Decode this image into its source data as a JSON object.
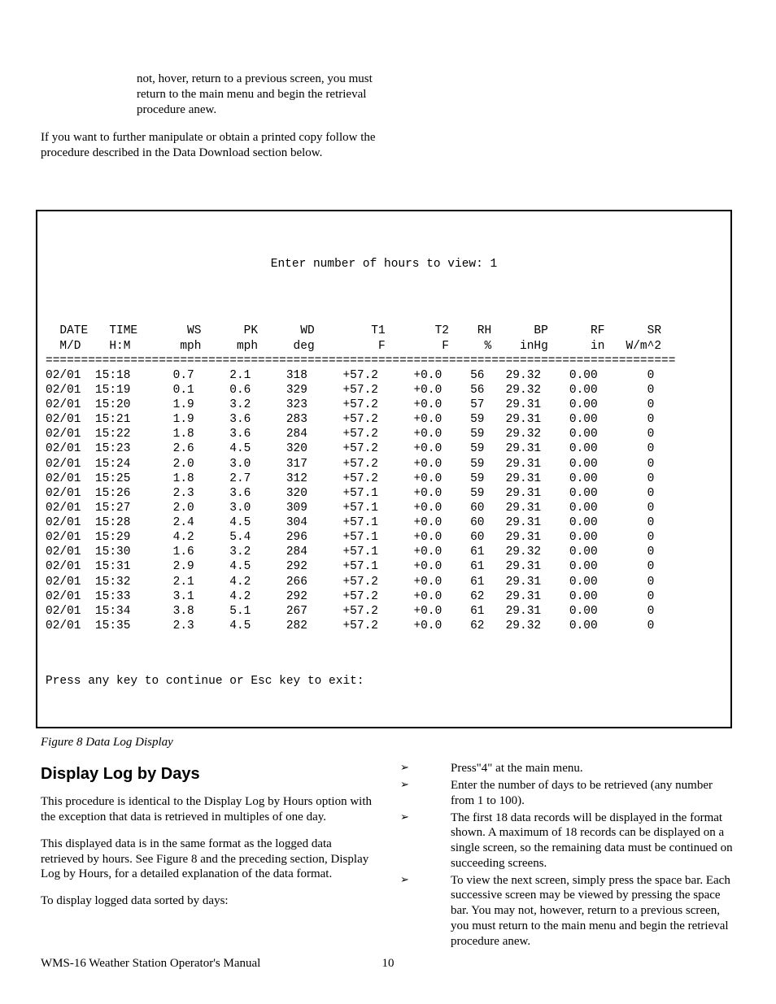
{
  "pre": {
    "hover_text": "not, hover, return to a previous screen, you must return to the main menu and begin the retrieval procedure anew.",
    "manip_text": "If you want to further manipulate or obtain a printed copy follow the procedure described in the Data Download section below."
  },
  "terminal": {
    "prompt": "Enter number of hours to view: 1",
    "headers": [
      {
        "l1": "DATE",
        "l2": "M/D"
      },
      {
        "l1": "TIME",
        "l2": "H:M"
      },
      {
        "l1": "WS",
        "l2": "mph"
      },
      {
        "l1": "PK",
        "l2": "mph"
      },
      {
        "l1": "WD",
        "l2": "deg"
      },
      {
        "l1": "T1",
        "l2": "F"
      },
      {
        "l1": "T2",
        "l2": "F"
      },
      {
        "l1": "RH",
        "l2": "%"
      },
      {
        "l1": "BP",
        "l2": "inHg"
      },
      {
        "l1": "RF",
        "l2": "in"
      },
      {
        "l1": "SR",
        "l2": "W/m^2"
      }
    ],
    "rows": [
      {
        "date": "02/01",
        "time": "15:18",
        "ws": "0.7",
        "pk": "2.1",
        "wd": "318",
        "t1": "+57.2",
        "t2": "+0.0",
        "rh": "56",
        "bp": "29.32",
        "rf": "0.00",
        "sr": "0"
      },
      {
        "date": "02/01",
        "time": "15:19",
        "ws": "0.1",
        "pk": "0.6",
        "wd": "329",
        "t1": "+57.2",
        "t2": "+0.0",
        "rh": "56",
        "bp": "29.32",
        "rf": "0.00",
        "sr": "0"
      },
      {
        "date": "02/01",
        "time": "15:20",
        "ws": "1.9",
        "pk": "3.2",
        "wd": "323",
        "t1": "+57.2",
        "t2": "+0.0",
        "rh": "57",
        "bp": "29.31",
        "rf": "0.00",
        "sr": "0"
      },
      {
        "date": "02/01",
        "time": "15:21",
        "ws": "1.9",
        "pk": "3.6",
        "wd": "283",
        "t1": "+57.2",
        "t2": "+0.0",
        "rh": "59",
        "bp": "29.31",
        "rf": "0.00",
        "sr": "0"
      },
      {
        "date": "02/01",
        "time": "15:22",
        "ws": "1.8",
        "pk": "3.6",
        "wd": "284",
        "t1": "+57.2",
        "t2": "+0.0",
        "rh": "59",
        "bp": "29.32",
        "rf": "0.00",
        "sr": "0"
      },
      {
        "date": "02/01",
        "time": "15:23",
        "ws": "2.6",
        "pk": "4.5",
        "wd": "320",
        "t1": "+57.2",
        "t2": "+0.0",
        "rh": "59",
        "bp": "29.31",
        "rf": "0.00",
        "sr": "0"
      },
      {
        "date": "02/01",
        "time": "15:24",
        "ws": "2.0",
        "pk": "3.0",
        "wd": "317",
        "t1": "+57.2",
        "t2": "+0.0",
        "rh": "59",
        "bp": "29.31",
        "rf": "0.00",
        "sr": "0"
      },
      {
        "date": "02/01",
        "time": "15:25",
        "ws": "1.8",
        "pk": "2.7",
        "wd": "312",
        "t1": "+57.2",
        "t2": "+0.0",
        "rh": "59",
        "bp": "29.31",
        "rf": "0.00",
        "sr": "0"
      },
      {
        "date": "02/01",
        "time": "15:26",
        "ws": "2.3",
        "pk": "3.6",
        "wd": "320",
        "t1": "+57.1",
        "t2": "+0.0",
        "rh": "59",
        "bp": "29.31",
        "rf": "0.00",
        "sr": "0"
      },
      {
        "date": "02/01",
        "time": "15:27",
        "ws": "2.0",
        "pk": "3.0",
        "wd": "309",
        "t1": "+57.1",
        "t2": "+0.0",
        "rh": "60",
        "bp": "29.31",
        "rf": "0.00",
        "sr": "0"
      },
      {
        "date": "02/01",
        "time": "15:28",
        "ws": "2.4",
        "pk": "4.5",
        "wd": "304",
        "t1": "+57.1",
        "t2": "+0.0",
        "rh": "60",
        "bp": "29.31",
        "rf": "0.00",
        "sr": "0"
      },
      {
        "date": "02/01",
        "time": "15:29",
        "ws": "4.2",
        "pk": "5.4",
        "wd": "296",
        "t1": "+57.1",
        "t2": "+0.0",
        "rh": "60",
        "bp": "29.31",
        "rf": "0.00",
        "sr": "0"
      },
      {
        "date": "02/01",
        "time": "15:30",
        "ws": "1.6",
        "pk": "3.2",
        "wd": "284",
        "t1": "+57.1",
        "t2": "+0.0",
        "rh": "61",
        "bp": "29.32",
        "rf": "0.00",
        "sr": "0"
      },
      {
        "date": "02/01",
        "time": "15:31",
        "ws": "2.9",
        "pk": "4.5",
        "wd": "292",
        "t1": "+57.1",
        "t2": "+0.0",
        "rh": "61",
        "bp": "29.31",
        "rf": "0.00",
        "sr": "0"
      },
      {
        "date": "02/01",
        "time": "15:32",
        "ws": "2.1",
        "pk": "4.2",
        "wd": "266",
        "t1": "+57.2",
        "t2": "+0.0",
        "rh": "61",
        "bp": "29.31",
        "rf": "0.00",
        "sr": "0"
      },
      {
        "date": "02/01",
        "time": "15:33",
        "ws": "3.1",
        "pk": "4.2",
        "wd": "292",
        "t1": "+57.2",
        "t2": "+0.0",
        "rh": "62",
        "bp": "29.31",
        "rf": "0.00",
        "sr": "0"
      },
      {
        "date": "02/01",
        "time": "15:34",
        "ws": "3.8",
        "pk": "5.1",
        "wd": "267",
        "t1": "+57.2",
        "t2": "+0.0",
        "rh": "61",
        "bp": "29.31",
        "rf": "0.00",
        "sr": "0"
      },
      {
        "date": "02/01",
        "time": "15:35",
        "ws": "2.3",
        "pk": "4.5",
        "wd": "282",
        "t1": "+57.2",
        "t2": "+0.0",
        "rh": "62",
        "bp": "29.32",
        "rf": "0.00",
        "sr": "0"
      }
    ],
    "continue": "Press any key to continue or Esc key to exit:"
  },
  "figure_caption": "Figure 8 Data Log Display",
  "section_heading": "Display Log by Days",
  "left_paragraphs": [
    "This procedure is identical to the Display Log by Hours option with the exception that data is retrieved in multiples of one day.",
    "This displayed data is in the same format as the logged data retrieved by hours. See Figure 8 and the preceding section, Display Log by Hours, for a detailed explanation of the data format.",
    "To display logged data sorted by days:"
  ],
  "right_bullets": [
    "Press\"4\" at the main menu.",
    "Enter the number of days to be retrieved (any number from 1 to 100).",
    "The first 18 data records will be displayed in the format shown. A maximum of 18 records can be displayed on a single screen, so the remaining data must be continued on succeeding screens.",
    "To view the next screen, simply press the space bar. Each successive screen may be viewed by pressing the space bar. You may not, however, return to a previous screen, you must return to the main menu and begin the retrieval procedure anew."
  ],
  "footer": {
    "left": "WMS-16 Weather Station Operator's Manual",
    "page": "10"
  }
}
